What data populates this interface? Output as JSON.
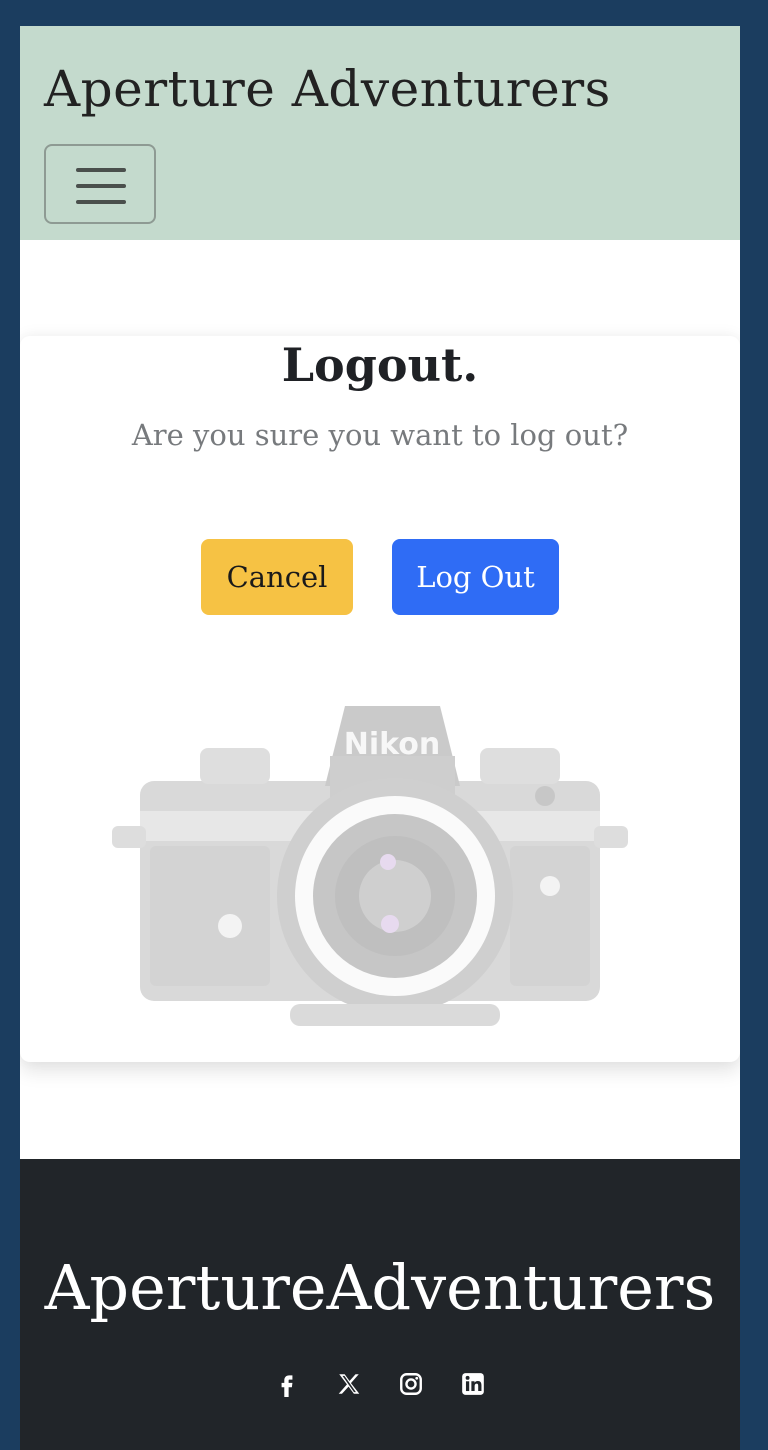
{
  "header": {
    "brand": "Aperture Adventurers",
    "menu_icon": "hamburger-menu-icon"
  },
  "logout_card": {
    "title": "Logout.",
    "message": "Are you sure you want to log out?",
    "cancel_label": "Cancel",
    "logout_label": "Log Out",
    "image_alt": "Nikon camera"
  },
  "footer": {
    "brand": "ApertureAdventurers",
    "social_icons": [
      "facebook-icon",
      "x-icon",
      "instagram-icon",
      "linkedin-icon"
    ]
  },
  "colors": {
    "page_background": "#1b3d5f",
    "navbar": "#c4dacd",
    "cancel_button": "#f6c244",
    "logout_button": "#2f6cf5",
    "footer": "#212529"
  }
}
